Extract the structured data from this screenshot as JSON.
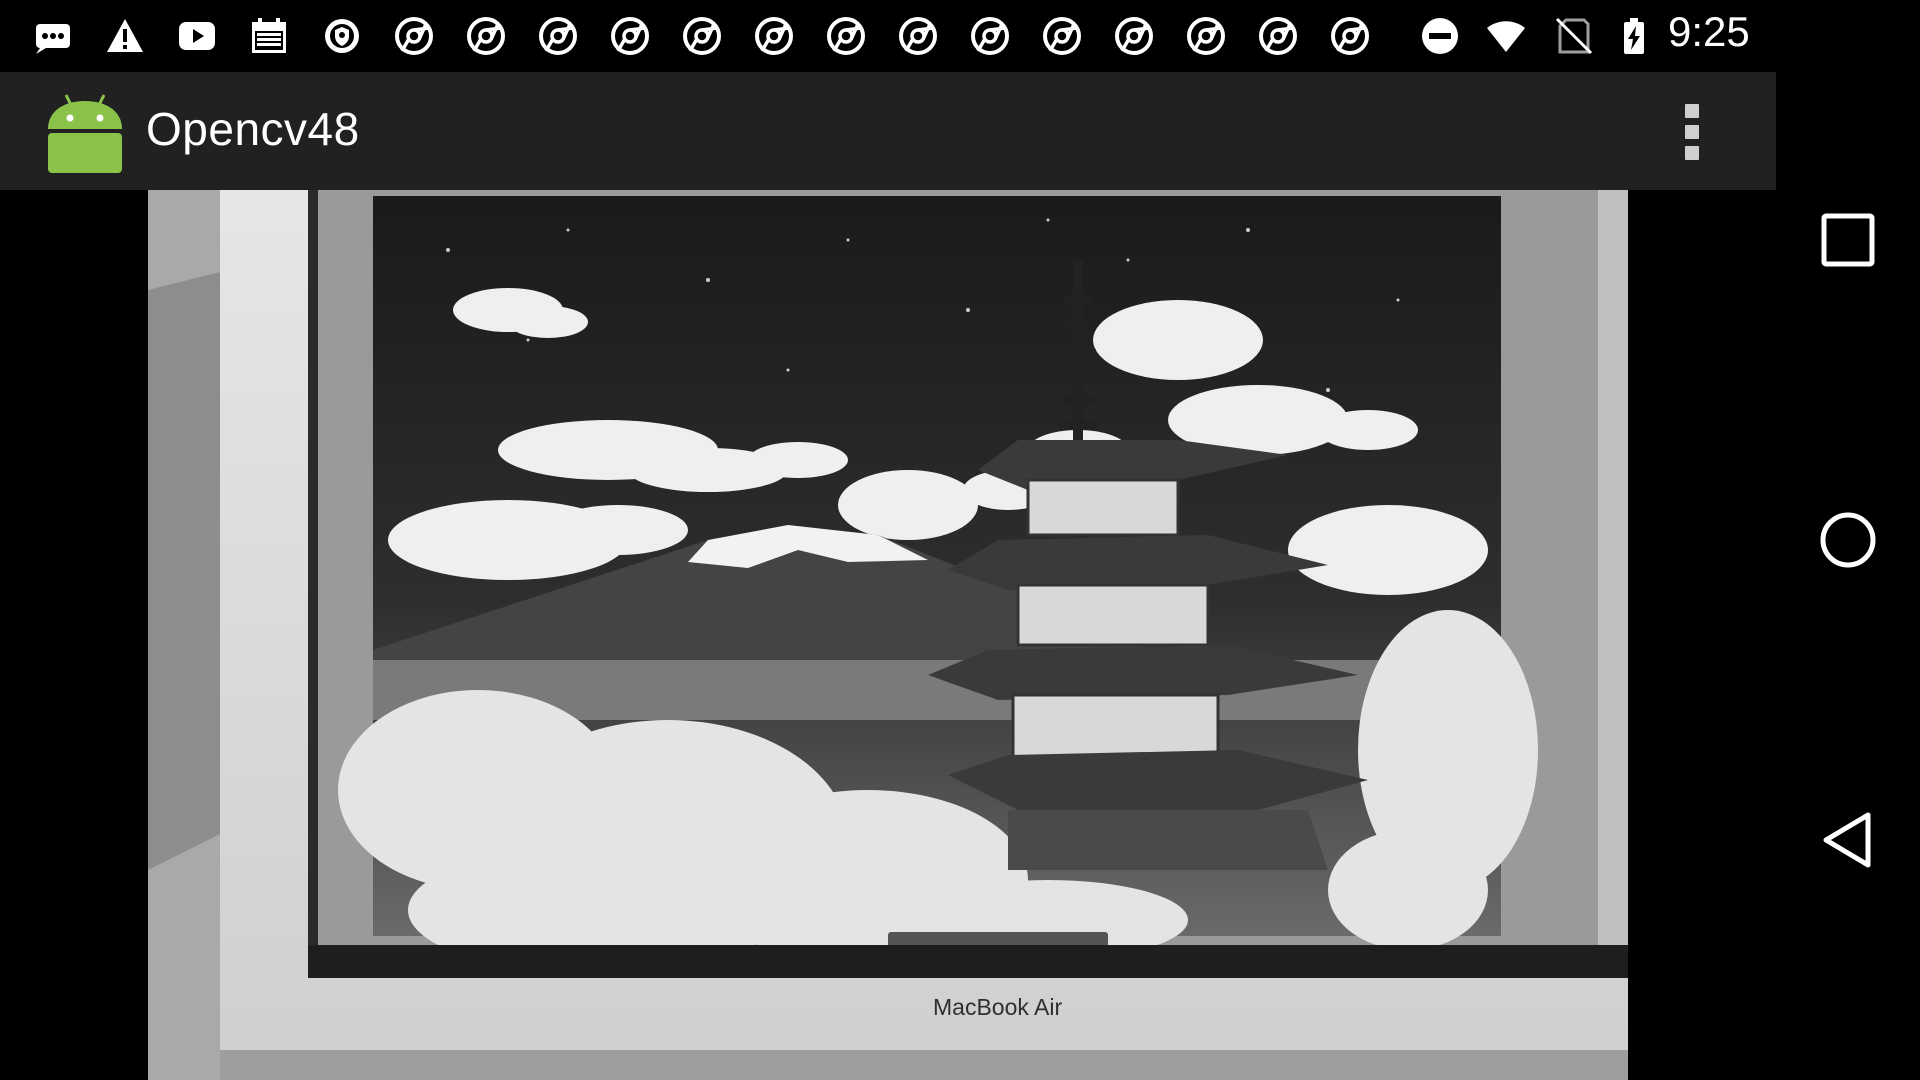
{
  "status_bar": {
    "time": "9:25",
    "notification_icons": [
      "more-notifications-icon",
      "warning-icon",
      "youtube-icon",
      "calendar-icon",
      "vpn-shield-icon",
      "chrome-icon",
      "chrome-icon",
      "chrome-icon",
      "chrome-icon",
      "chrome-icon",
      "chrome-icon",
      "chrome-icon",
      "chrome-icon",
      "chrome-icon",
      "chrome-icon",
      "chrome-icon",
      "chrome-icon",
      "chrome-icon",
      "chrome-icon"
    ],
    "system_icons": [
      "do-not-disturb-icon",
      "wifi-icon",
      "no-sim-icon",
      "battery-charging-icon"
    ]
  },
  "action_bar": {
    "title": "Opencv48",
    "app_icon": "android-robot-icon",
    "overflow_icon": "overflow-menu-icon"
  },
  "camera_preview": {
    "laptop_label": "MacBook Air",
    "mode": "grayscale"
  },
  "nav_bar": {
    "buttons": [
      "recent-apps-icon",
      "home-icon",
      "back-icon"
    ]
  },
  "colors": {
    "status_bar_bg": "#000000",
    "action_bar_bg": "#212121",
    "android_green": "#8BC34A",
    "icon_white": "#ffffff"
  }
}
